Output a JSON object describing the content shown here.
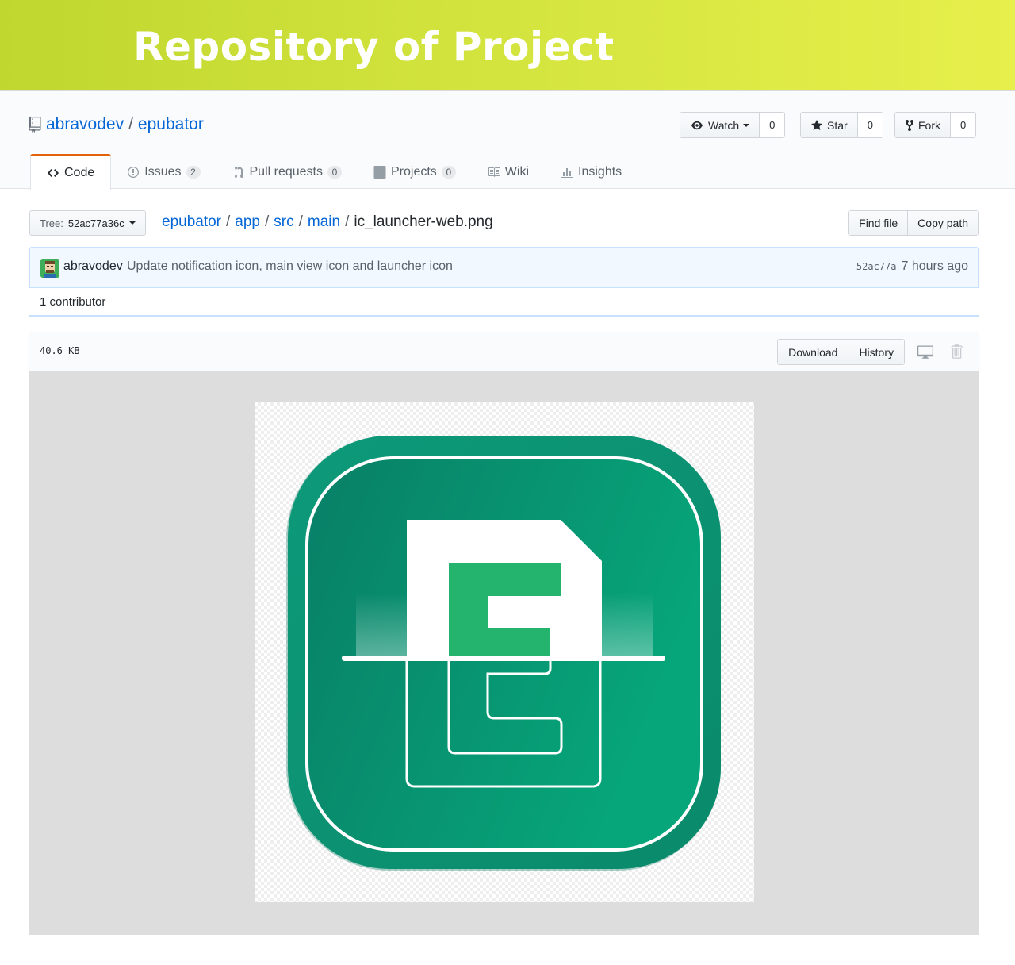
{
  "banner": {
    "title": "Repository of Project"
  },
  "repo": {
    "owner": "abravodev",
    "separator": "/",
    "name": "epubator"
  },
  "actions": {
    "watch_label": "Watch",
    "watch_count": "0",
    "star_label": "Star",
    "star_count": "0",
    "fork_label": "Fork",
    "fork_count": "0"
  },
  "tabs": [
    {
      "label": "Code",
      "icon": "code-icon"
    },
    {
      "label": "Issues",
      "count": "2",
      "icon": "issue-icon"
    },
    {
      "label": "Pull requests",
      "count": "0",
      "icon": "pull-request-icon"
    },
    {
      "label": "Projects",
      "count": "0",
      "icon": "project-icon"
    },
    {
      "label": "Wiki",
      "icon": "book-icon"
    },
    {
      "label": "Insights",
      "icon": "graph-icon"
    }
  ],
  "branch": {
    "label": "Tree:",
    "value": "52ac77a36c"
  },
  "breadcrumb": {
    "parts": [
      "epubator",
      "app",
      "src",
      "main"
    ],
    "file": "ic_launcher-web.png",
    "sep": "/"
  },
  "file_actions": {
    "find_file": "Find file",
    "copy_path": "Copy path"
  },
  "commit": {
    "author": "abravodev",
    "message": "Update notification icon, main view icon and launcher icon",
    "sha": "52ac77a",
    "time": "7 hours ago"
  },
  "contributors": "1 contributor",
  "file": {
    "size": "40.6 KB",
    "download_label": "Download",
    "history_label": "History"
  },
  "colors": {
    "accent": "#0366d6",
    "tab_active": "#e36209",
    "icon_green_dark": "#0b8a6e",
    "icon_green_light": "#11b07f"
  }
}
